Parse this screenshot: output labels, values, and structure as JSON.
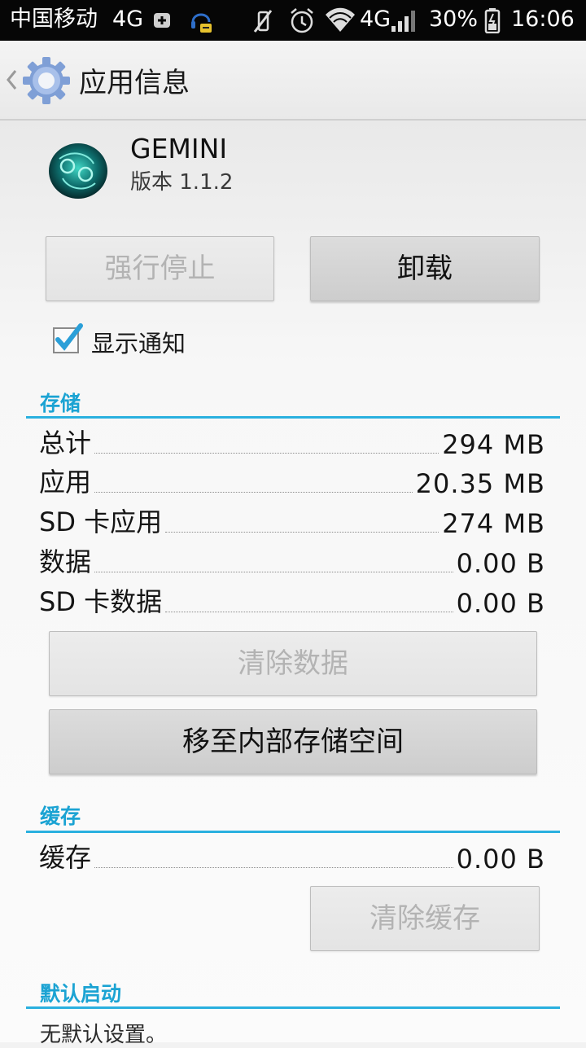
{
  "status_bar": {
    "carrier": "中国移动",
    "network_left": "4G",
    "network_right": "4G",
    "battery": "30%",
    "time": "16:06"
  },
  "action_bar": {
    "title": "应用信息"
  },
  "app": {
    "name": "GEMINI",
    "version": "版本 1.1.2"
  },
  "buttons": {
    "force_stop": "强行停止",
    "uninstall": "卸载"
  },
  "notification": {
    "label": "显示通知",
    "checked": true
  },
  "storage": {
    "title": "存储",
    "rows": [
      {
        "label": "总计",
        "value": "294 MB"
      },
      {
        "label": "应用",
        "value": "20.35 MB"
      },
      {
        "label": "SD 卡应用",
        "value": "274 MB"
      },
      {
        "label": "数据",
        "value": "0.00 B"
      },
      {
        "label": "SD 卡数据",
        "value": "0.00 B"
      }
    ],
    "clear_data": "清除数据",
    "move_internal": "移至内部存储空间"
  },
  "cache": {
    "title": "缓存",
    "row": {
      "label": "缓存",
      "value": "0.00 B"
    },
    "clear_cache": "清除缓存"
  },
  "default_launch": {
    "title": "默认启动",
    "text": "无默认设置。"
  },
  "colors": {
    "accent": "#2ab0df",
    "section_title": "#1ba3d3"
  }
}
